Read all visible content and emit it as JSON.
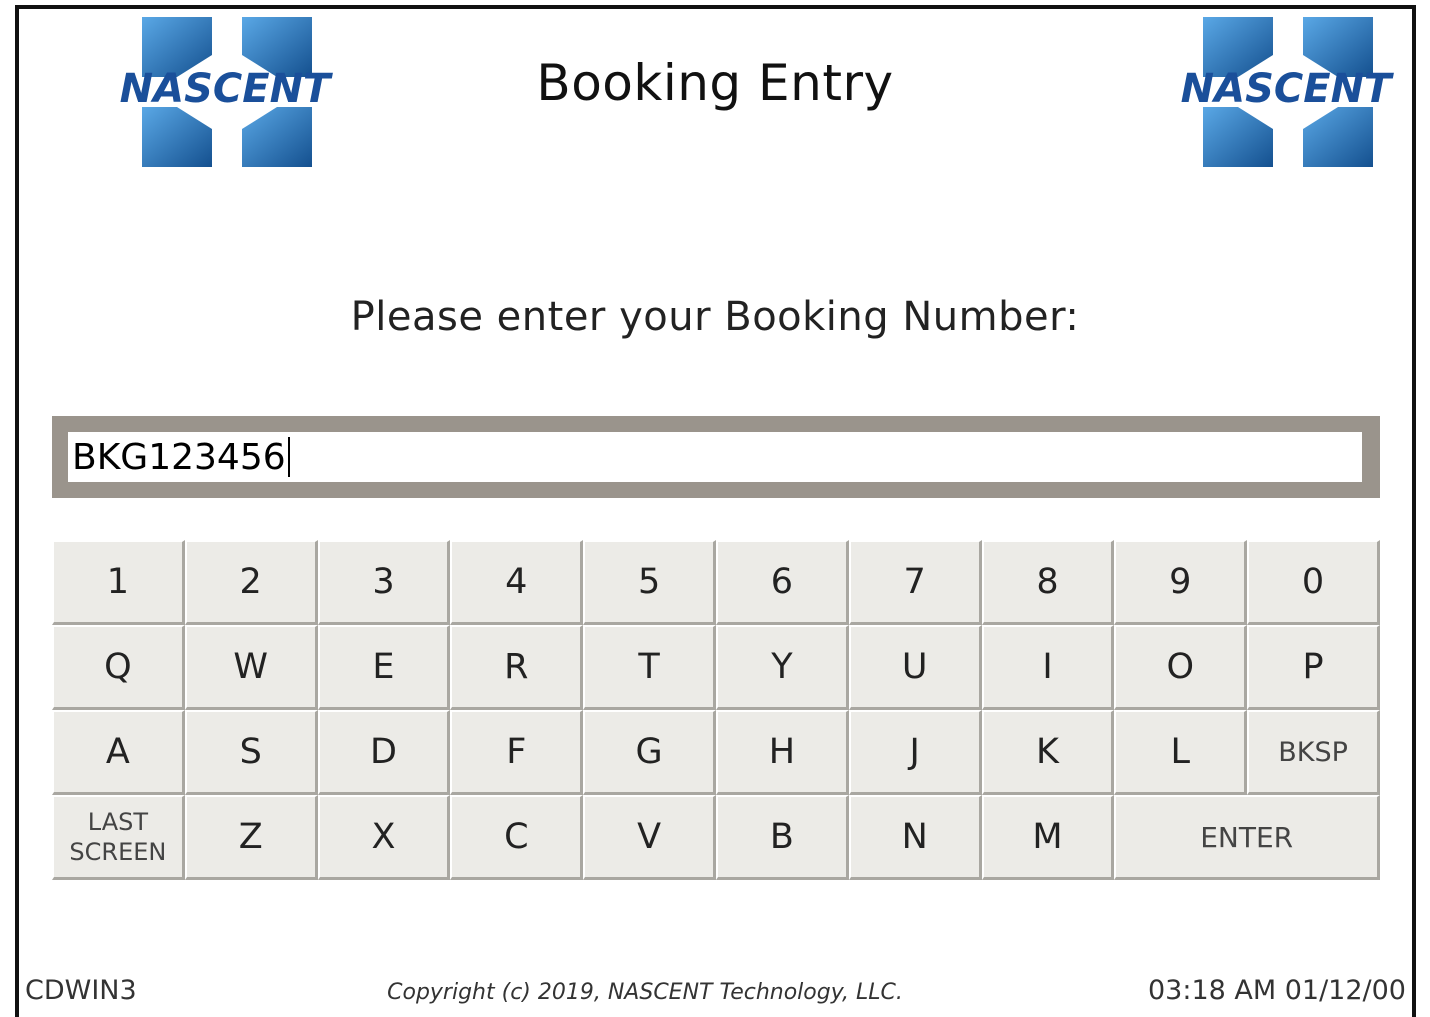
{
  "header": {
    "title": "Booking Entry",
    "logo_text": "NASCENT"
  },
  "prompt": "Please enter your Booking Number:",
  "booking_input": {
    "value": "BKG123456"
  },
  "keyboard": {
    "row1": [
      "1",
      "2",
      "3",
      "4",
      "5",
      "6",
      "7",
      "8",
      "9",
      "0"
    ],
    "row2": [
      "Q",
      "W",
      "E",
      "R",
      "T",
      "Y",
      "U",
      "I",
      "O",
      "P"
    ],
    "row3": [
      "A",
      "S",
      "D",
      "F",
      "G",
      "H",
      "J",
      "K",
      "L"
    ],
    "backspace": "BKSP",
    "last_screen_line1": "LAST",
    "last_screen_line2": "SCREEN",
    "row4": [
      "Z",
      "X",
      "C",
      "V",
      "B",
      "N",
      "M"
    ],
    "enter": "ENTER"
  },
  "footer": {
    "station": "CDWIN3",
    "copyright": "Copyright (c) 2019, NASCENT Technology, LLC.",
    "clock": "03:18 AM 01/12/00"
  },
  "colors": {
    "logo_blue": "#1f6fb8",
    "logo_text": "#1a4f9a",
    "input_border": "#9a948c",
    "key_face": "#ecebe7"
  }
}
